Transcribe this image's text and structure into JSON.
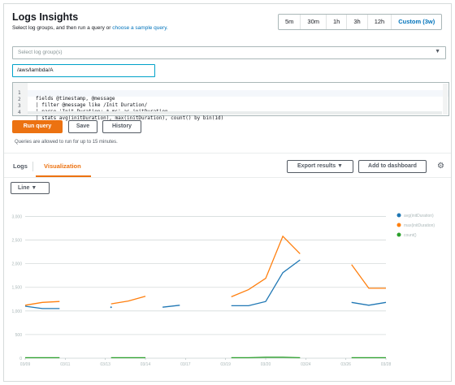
{
  "header": {
    "title": "Logs Insights",
    "subtitle_prefix": "Select log groups, and then run a query or",
    "subtitle_link": "choose a sample query."
  },
  "time_range": [
    "5m",
    "30m",
    "1h",
    "3h",
    "12h",
    "Custom (3w)"
  ],
  "log_groups": {
    "placeholder": "Select log group(s)",
    "selected": "/aws/lambda/A"
  },
  "query_lines": [
    {
      "n": "1",
      "text": "fields @timestamp, @message"
    },
    {
      "n": "2",
      "text": "| filter @message like /Init Duration/"
    },
    {
      "n": "3",
      "text": "| parse 'Init Duration: * ms' as initDuration"
    },
    {
      "n": "4",
      "text": "| stats avg(initDuration), max(initDuration), count() by bin(1d)"
    }
  ],
  "buttons": {
    "run": "Run query",
    "save": "Save",
    "history": "History",
    "export": "Export results",
    "dashboard": "Add to dashboard"
  },
  "note": "Queries are allowed to run for up to 15 minutes.",
  "tabs": [
    "Logs",
    "Visualization"
  ],
  "chart_type": "Line",
  "colors": {
    "accent": "#ec7211",
    "link": "#0073bb",
    "series_blue": "#1f77b4",
    "series_orange": "#ff7f0e",
    "series_green": "#2ca02c"
  },
  "chart_data": {
    "type": "line",
    "title": "",
    "xlabel": "",
    "ylabel": "",
    "x": [
      "03/09",
      "03/10",
      "03/11",
      "03/12",
      "03/13",
      "03/14",
      "03/15",
      "03/16",
      "03/17",
      "03/18",
      "03/19",
      "03/20",
      "03/21",
      "03/22",
      "03/23",
      "03/24",
      "03/25",
      "03/26",
      "03/27",
      "03/28"
    ],
    "x_ticks": [
      "03/09",
      "03/11",
      "03/13",
      "03/14",
      "03/17",
      "03/19",
      "03/20",
      "03/24",
      "03/26",
      "03/28"
    ],
    "y_ticks": [
      "0",
      "500",
      "1,000",
      "1,500",
      "2,000",
      "2,500",
      "3,000"
    ],
    "ylim": [
      0,
      3300
    ],
    "grid": true,
    "legend_position": "right",
    "series": [
      {
        "name": "avg(initDuration)",
        "color": "#1f77b4",
        "values": [
          1100,
          1050,
          1050,
          null,
          null,
          1080,
          null,
          null,
          1080,
          1120,
          null,
          null,
          1110,
          1110,
          1200,
          1810,
          2080,
          null,
          null,
          1180,
          1120,
          1180
        ]
      },
      {
        "name": "max(initDuration)",
        "color": "#ff7f0e",
        "values": [
          1120,
          1180,
          1200,
          null,
          null,
          1150,
          1210,
          1310,
          null,
          null,
          null,
          null,
          1300,
          1450,
          1690,
          2580,
          2210,
          null,
          null,
          1980,
          1480,
          1480
        ]
      },
      {
        "name": "count()",
        "color": "#2ca02c",
        "values": [
          10,
          10,
          10,
          null,
          null,
          10,
          10,
          10,
          null,
          null,
          null,
          null,
          10,
          10,
          20,
          20,
          10,
          null,
          null,
          10,
          10,
          10
        ]
      }
    ]
  }
}
